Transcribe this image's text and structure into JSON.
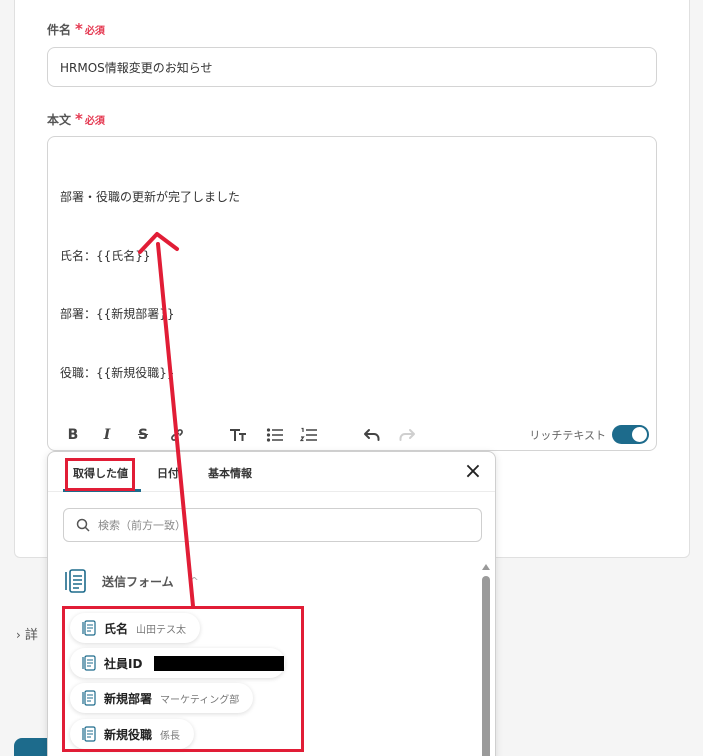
{
  "form": {
    "subject_label": "件名",
    "required_star": "*",
    "required_text": "必須",
    "subject_value": "HRMOS情報変更のお知らせ",
    "body_label": "本文",
    "body_lines": [
      "部署・役職の更新が完了しました",
      "氏名：{{氏名}}",
      "部署：{{新規部署}}",
      "役職：{{新規役職}}"
    ],
    "rich_text_label": "リッチテキスト",
    "rich_text_enabled": true
  },
  "side": {
    "details_label": "詳"
  },
  "popup": {
    "tabs": [
      "取得した値",
      "日付",
      "基本情報"
    ],
    "active_tab": 0,
    "search_placeholder": "検索（前方一致）",
    "group_label": "送信フォーム",
    "items": [
      {
        "name": "氏名",
        "value": "山田テス太"
      },
      {
        "name": "社員ID",
        "value": ""
      },
      {
        "name": "新規部署",
        "value": "マーケティング部"
      },
      {
        "name": "新規役職",
        "value": "係長"
      }
    ]
  },
  "colors": {
    "accent": "#1d6b8c",
    "required": "#e53a52",
    "annotation": "#e11d36"
  }
}
